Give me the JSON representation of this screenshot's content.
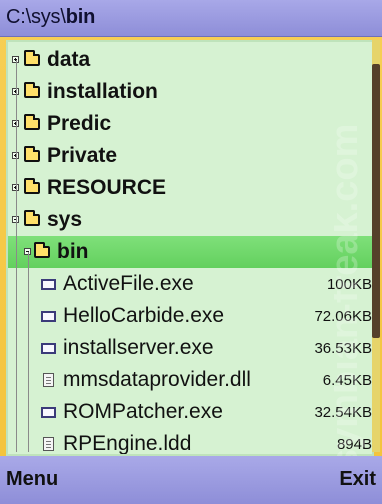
{
  "window": {
    "path_prefix": "C:\\sys\\",
    "path_current": "bin"
  },
  "items": [
    {
      "type": "folder",
      "label": "data",
      "expanded": false
    },
    {
      "type": "folder",
      "label": "installation",
      "expanded": false
    },
    {
      "type": "folder",
      "label": "Predic",
      "expanded": false
    },
    {
      "type": "folder",
      "label": "Private",
      "expanded": false
    },
    {
      "type": "folder",
      "label": "RESOURCE",
      "expanded": false
    },
    {
      "type": "folder",
      "label": "sys",
      "expanded": true
    },
    {
      "type": "folder",
      "label": "bin",
      "expanded": true,
      "selected": true
    },
    {
      "type": "file",
      "label": "ActiveFile.exe",
      "size": "100KB",
      "icon": "exe-icon"
    },
    {
      "type": "file",
      "label": "HelloCarbide.exe",
      "size": "72.06KB",
      "icon": "exe-icon"
    },
    {
      "type": "file",
      "label": "installserver.exe",
      "size": "36.53KB",
      "icon": "exe-icon"
    },
    {
      "type": "file",
      "label": "mmsdataprovider.dll",
      "size": "6.45KB",
      "icon": "dll-icon"
    },
    {
      "type": "file",
      "label": "ROMPatcher.exe",
      "size": "32.54KB",
      "icon": "exe-icon"
    },
    {
      "type": "file",
      "label": "RPEngine.ldd",
      "size": "894B",
      "icon": "ldd-icon"
    }
  ],
  "softkeys": {
    "left": "Menu",
    "right": "Exit"
  },
  "watermark": {
    "text": "symbian-freak.com"
  },
  "colors": {
    "frame": "#f3c33a",
    "title": "#9a9ae0",
    "list": "#d6f2d2",
    "selected": "#6fda69",
    "scroll_thumb": "#55402a"
  }
}
